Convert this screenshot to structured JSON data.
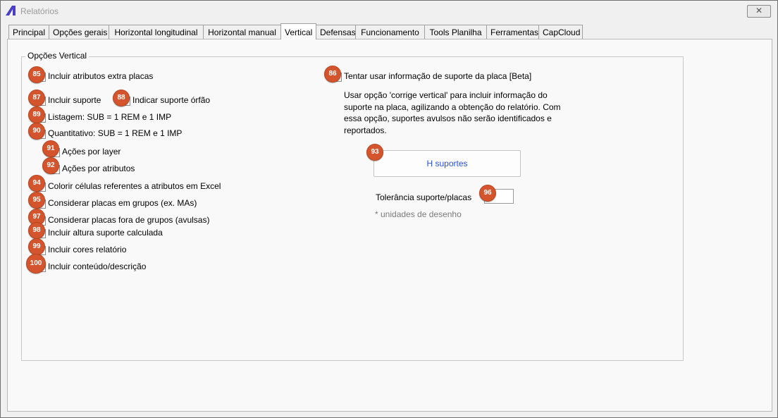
{
  "window": {
    "title": "Relatórios",
    "close_glyph": "✕"
  },
  "tabs": [
    {
      "label": "Principal"
    },
    {
      "label": "Opções gerais"
    },
    {
      "label": "Horizontal longitudinal"
    },
    {
      "label": "Horizontal manual"
    },
    {
      "label": "Vertical",
      "active": true
    },
    {
      "label": "Defensas"
    },
    {
      "label": "Funcionamento"
    },
    {
      "label": "Tools Planilha"
    },
    {
      "label": "Ferramentas"
    },
    {
      "label": "CapCloud"
    }
  ],
  "group": {
    "title": "Opções Vertical"
  },
  "options": {
    "incluir_atributos_extra": {
      "label": "Incluir atributos extra placas",
      "badge": "85"
    },
    "incluir_suporte": {
      "label": "Incluir suporte",
      "badge": "87"
    },
    "indicar_suporte_orfao": {
      "label": "Indicar suporte órfão",
      "badge": "88"
    },
    "listagem": {
      "label": "Listagem: SUB = 1 REM e 1 IMP",
      "badge": "89"
    },
    "quantitativo": {
      "label": "Quantitativo: SUB = 1 REM e 1 IMP",
      "badge": "90"
    },
    "acoes_layer": {
      "label": "Ações por layer",
      "badge": "91"
    },
    "acoes_atributos": {
      "label": "Ações por atributos",
      "badge": "92"
    },
    "colorir_celulas": {
      "label": "Colorir células referentes a atributos em Excel",
      "badge": "94"
    },
    "placas_grupos": {
      "label": "Considerar placas em grupos (ex. MAs)",
      "badge": "95"
    },
    "placas_fora_grupos": {
      "label": "Considerar placas fora de grupos (avulsas)",
      "badge": "97"
    },
    "altura_suporte": {
      "label": "Incluir altura suporte calculada",
      "badge": "98"
    },
    "cores_relatorio": {
      "label": "Incluir cores relatório",
      "badge": "99"
    },
    "conteudo_descricao": {
      "label": "Incluir conteúdo/descrição",
      "badge": "100"
    },
    "tentar_suporte": {
      "label": "Tentar usar informação de suporte da placa [Beta]",
      "badge": "86"
    }
  },
  "right": {
    "description": "Usar opção 'corrige vertical' para incluir informação do suporte na placa, agilizando a obtenção do relatório. Com essa opção, suportes avulsos não serão identificados e reportados.",
    "h_button": {
      "label": "H suportes",
      "badge": "93"
    },
    "tolerance": {
      "label": "Tolerância suporte/placas",
      "value": "",
      "badge": "96"
    },
    "units_note": "* unidades de desenho"
  },
  "colors": {
    "badge": "#d4552d",
    "link_text": "#2b50d6",
    "app_icon": "#4a3fc8"
  },
  "icons": {
    "app": "relatorios-app-icon",
    "close": "close-icon"
  }
}
